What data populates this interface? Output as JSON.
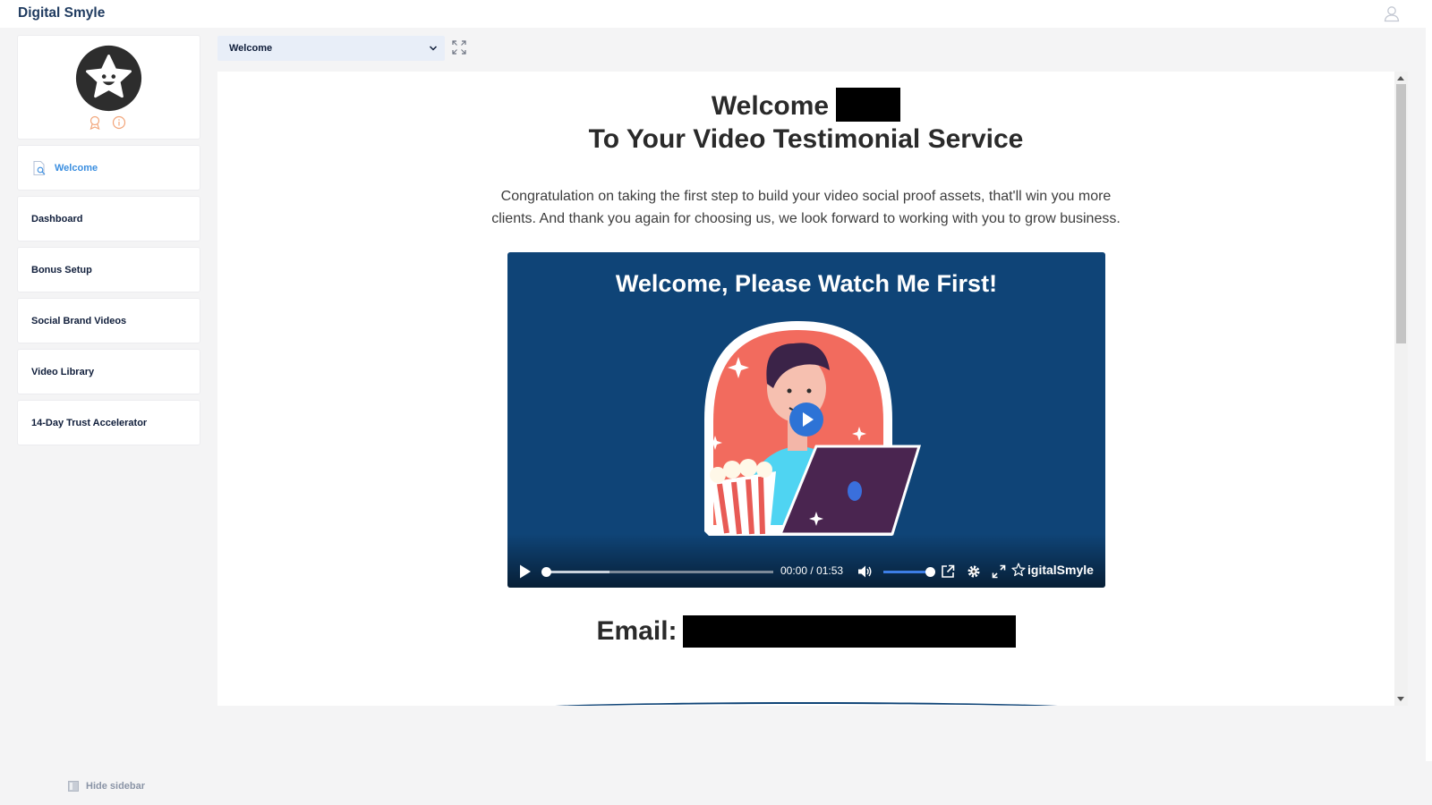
{
  "app": {
    "brand": "Digital Smyle"
  },
  "topbar": {
    "user_icon": "user-icon"
  },
  "sidebar": {
    "logo_icon": "star-smiley-logo",
    "mini_icons": [
      "badge-icon",
      "info-icon"
    ],
    "items": [
      {
        "label": "Welcome",
        "active": true,
        "icon": "page-search-icon"
      },
      {
        "label": "Dashboard",
        "active": false
      },
      {
        "label": "Bonus Setup",
        "active": false
      },
      {
        "label": "Social Brand Videos",
        "active": false
      },
      {
        "label": "Video Library",
        "active": false
      },
      {
        "label": "14-Day Trust Accelerator",
        "active": false
      }
    ],
    "hide_label": "Hide sidebar"
  },
  "page_select": {
    "value": "Welcome"
  },
  "main": {
    "heading_line1": "Welcome",
    "heading_line2": "To Your Video Testimonial Service",
    "intro_line1": "Congratulation on taking the first step to build your video social proof assets, that'll win you more",
    "intro_line2": "clients. And thank you again for choosing us, we look forward to working with you to grow business.",
    "email_label": "Email:"
  },
  "video": {
    "title": "Welcome, Please Watch Me First!",
    "current_time": "00:00",
    "separator": "/",
    "duration": "01:53",
    "progress_fraction": 0.0,
    "buffered_fraction": 0.28,
    "volume_fraction": 1.0,
    "watermark": "igitalSmyle"
  },
  "colors": {
    "accent": "#3a8ee0",
    "video_bg": "#0f4477",
    "nav_text": "#0f1d3a",
    "select_bg": "#e8eef8"
  }
}
